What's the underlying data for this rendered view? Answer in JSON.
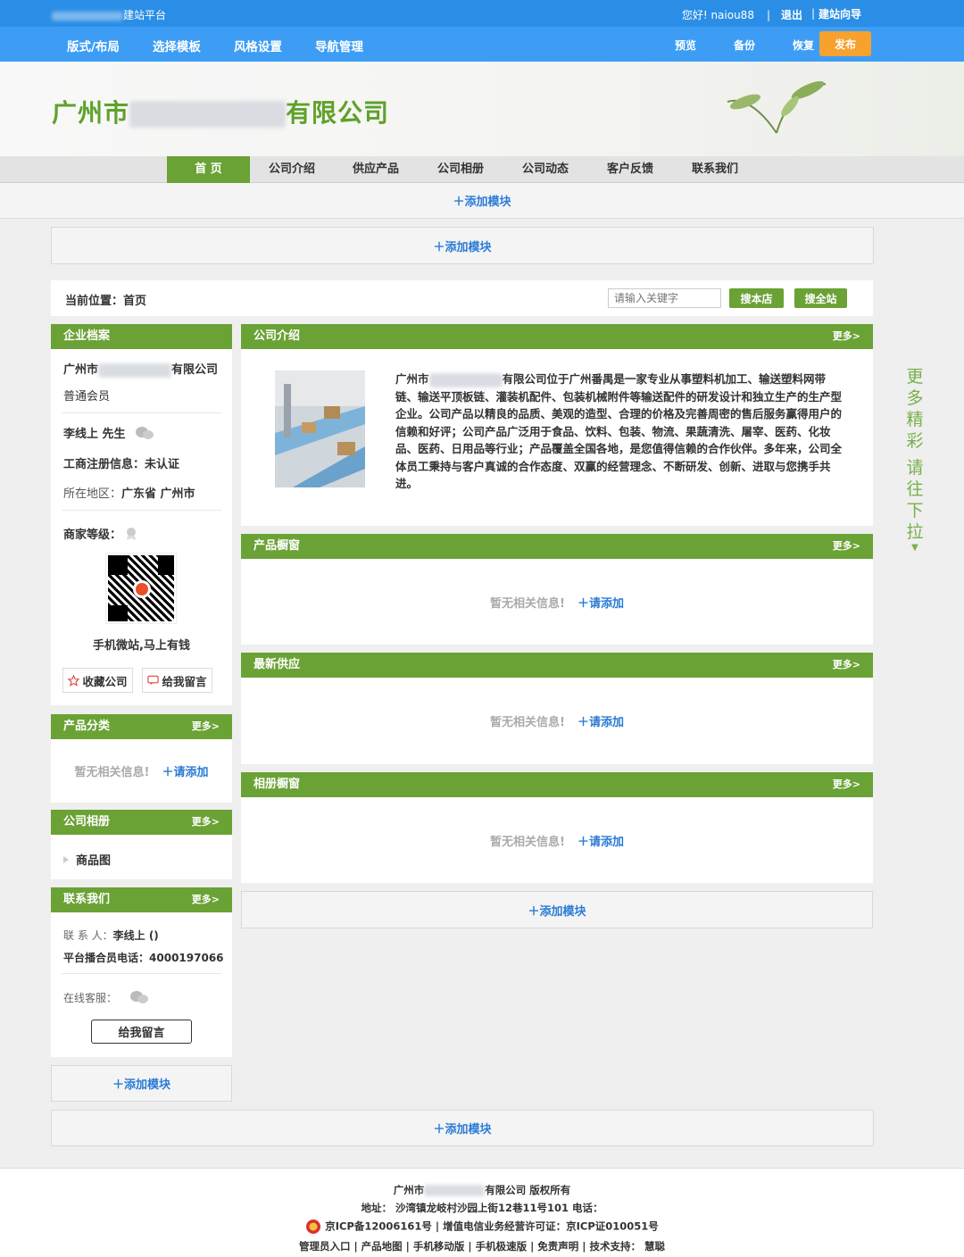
{
  "topbar": {
    "platform": "建站平台",
    "greeting": "您好! naiou88",
    "logout": "退出",
    "guide": "建站向导"
  },
  "toolbar": {
    "menu": [
      "版式/布局",
      "选择模板",
      "风格设置",
      "导航管理"
    ],
    "preview": "预览",
    "backup": "备份",
    "restore": "恢复",
    "publish": "发布"
  },
  "banner": {
    "title_prefix": "广州市",
    "title_suffix": "有限公司"
  },
  "nav": [
    "首 页",
    "公司介绍",
    "供应产品",
    "公司相册",
    "公司动态",
    "客户反馈",
    "联系我们"
  ],
  "add_module": "添加模块",
  "breadcrumb": {
    "label": "当前位置：",
    "current": "首页"
  },
  "search": {
    "placeholder": "请输入关键字",
    "shop_btn": "搜本店",
    "all_btn": "搜全站"
  },
  "profile": {
    "title": "企业档案",
    "company_prefix": "广州市",
    "company_suffix": "有限公司",
    "member": "普通会员",
    "contact": "李线上 先生",
    "reg_label": "工商注册信息：",
    "reg_value": "未认证",
    "area_label": "所在地区：",
    "area_value": "广东省 广州市",
    "level_label": "商家等级：",
    "qr_caption": "手机微站,马上有钱",
    "fav_btn": "收藏公司",
    "msg_btn": "给我留言"
  },
  "more": "更多>",
  "categories": {
    "title": "产品分类",
    "empty": "暂无相关信息!",
    "add": "请添加"
  },
  "album": {
    "title": "公司相册",
    "item": "商品图"
  },
  "contact": {
    "title": "联系我们",
    "person_label": "联 系 人：",
    "person_value": "李线上 ()",
    "phone_label": "平台播合员电话：",
    "phone_value": "4000197066",
    "online_label": "在线客服：",
    "msg_btn": "给我留言"
  },
  "intro": {
    "title": "公司介绍",
    "text_prefix": "广州市",
    "text": "有限公司位于广州番禺是一家专业从事塑料机加工、输送塑料网带链、输送平顶板链、灌装机配件、包装机械附件等输送配件的研发设计和独立生产的生产型企业。公司产品以精良的品质、美观的造型、合理的价格及完善周密的售后服务赢得用户的信赖和好评；公司产品广泛用于食品、饮料、包装、物流、果蔬清洗、屠宰、医药、化妆品、医药、日用品等行业；产品覆盖全国各地，是您值得信赖的合作伙伴。多年来，公司全体员工秉持与客户真诚的合作态度、双赢的经营理念、不断研发、创新、进取与您携手共进。"
  },
  "sections": [
    {
      "title": "产品橱窗",
      "empty": "暂无相关信息!",
      "add": "请添加"
    },
    {
      "title": "最新供应",
      "empty": "暂无相关信息!",
      "add": "请添加"
    },
    {
      "title": "相册橱窗",
      "empty": "暂无相关信息!",
      "add": "请添加"
    }
  ],
  "side_tip": [
    "更",
    "多",
    "精",
    "彩",
    "请",
    "往",
    "下",
    "拉"
  ],
  "footer": {
    "company_prefix": "广州市",
    "company_suffix": "有限公司 版权所有",
    "address": "地址：  沙湾镇龙岐村沙园上街12巷11号101 电话：",
    "icp": "京ICP备12006161号  |  增值电信业务经营许可证：京ICP证010051号",
    "links": "管理员入口  |  产品地图  |  手机移动版  |  手机极速版  |  免责声明  |  技术支持：  慧聪"
  }
}
